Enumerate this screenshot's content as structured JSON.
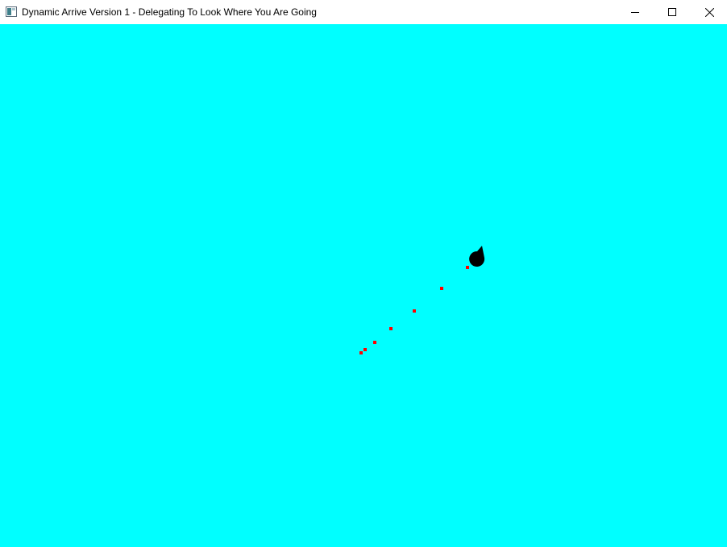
{
  "window": {
    "title": "Dynamic Arrive Version 1 - Delegating To Look Where You Are Going",
    "controls": {
      "minimize_icon": "minimize-icon",
      "maximize_icon": "maximize-icon",
      "close_icon": "close-icon"
    }
  },
  "scene": {
    "background_color": "#00ffff",
    "agent_color": "#000000",
    "trail_color": "#ff0000",
    "agent_icon": "teardrop-agent",
    "trail_marker": "breadcrumb-dot"
  }
}
